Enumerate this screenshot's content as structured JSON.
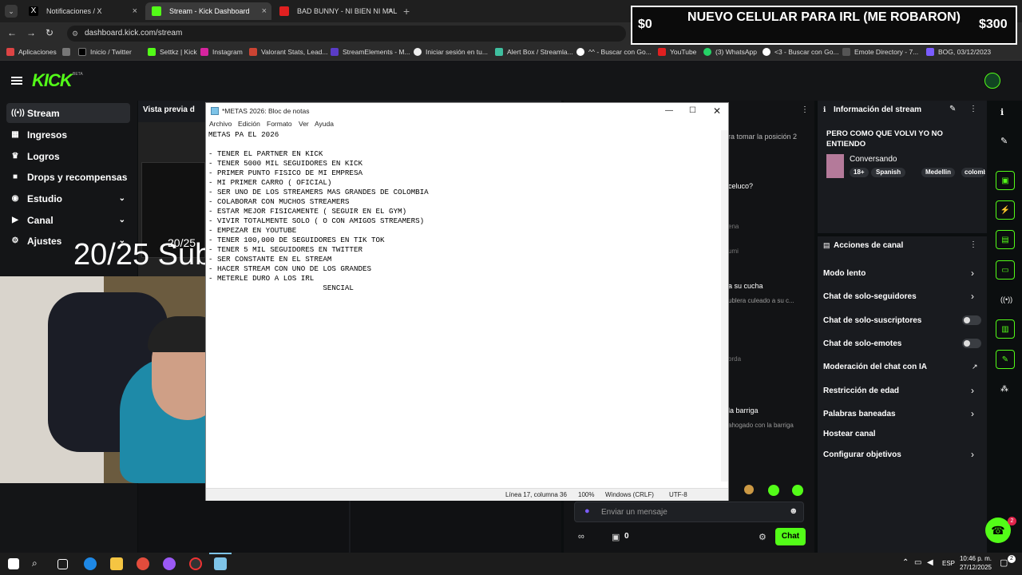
{
  "tabs": [
    {
      "label": "Notificaciones / X",
      "active": false
    },
    {
      "label": "Stream - Kick Dashboard",
      "active": true
    },
    {
      "label": "BAD BUNNY - NI BIEN NI MAL",
      "active": false
    }
  ],
  "address": "dashboard.kick.com/stream",
  "bookmarks": [
    "Aplicaciones",
    "Inicio / Twitter",
    "Settkz | Kick",
    "Instagram",
    "Valorant Stats, Lead...",
    "StreamElements - M...",
    "Iniciar sesión en tu...",
    "Alert Box / Streamla...",
    "^^ - Buscar con Go...",
    "YouTube",
    "(3) WhatsApp",
    "<3 - Buscar con Go...",
    "Emote Directory - 7...",
    "BOG, 03/12/2023"
  ],
  "overlay": {
    "left_amount": "$0",
    "title": "NUEVO CELULAR PARA IRL (ME ROBARON)",
    "right_amount": "$300"
  },
  "kick": {
    "logo": "KICK",
    "logo_badge": "BETA",
    "nav": [
      {
        "label": "Stream",
        "icon": "radio-icon",
        "active": true,
        "chevron": false
      },
      {
        "label": "Ingresos",
        "icon": "money-icon",
        "chevron": false
      },
      {
        "label": "Logros",
        "icon": "trophy-icon",
        "chevron": false
      },
      {
        "label": "Drops y recompensas",
        "icon": "gift-icon",
        "chevron": false
      },
      {
        "label": "Estudio",
        "icon": "studio-icon",
        "chevron": true
      },
      {
        "label": "Canal",
        "icon": "channel-icon",
        "chevron": true
      },
      {
        "label": "Ajustes",
        "icon": "gear-icon",
        "chevron": true
      }
    ],
    "preview_title": "Vista previa d",
    "sub_goal": "20/25 Sub",
    "sub_goal_small": "20/25",
    "chat_fragments": [
      "ra tomar la posición 2",
      "celuco?",
      "a su cucha",
      "ublera culeado a su c...",
      "la barriga",
      "ahogado con la barriga",
      "ena",
      "umi",
      "orda"
    ],
    "chat_placeholder": "Enviar un mensaje",
    "chat_count": "0",
    "chat_button": "Chat",
    "stream_info": {
      "header": "Información del stream",
      "title": "PERO COMO QUE VOLVI YO NO ENTIENDO",
      "category": "Conversando",
      "tags": [
        "18+",
        "Spanish",
        "Medellin",
        "colombi"
      ]
    },
    "channel_actions": {
      "header": "Acciones de canal",
      "items": [
        {
          "label": "Modo lento",
          "control": "chevron"
        },
        {
          "label": "Chat de solo-seguidores",
          "control": "chevron"
        },
        {
          "label": "Chat de solo-suscriptores",
          "control": "toggle"
        },
        {
          "label": "Chat de solo-emotes",
          "control": "toggle"
        },
        {
          "label": "Moderación del chat con IA",
          "control": "external"
        },
        {
          "label": "Restricción de edad",
          "control": "chevron"
        },
        {
          "label": "Palabras baneadas",
          "control": "chevron"
        },
        {
          "label": "Hostear canal",
          "control": "none"
        },
        {
          "label": "Configurar objetivos",
          "control": "chevron"
        }
      ]
    },
    "help_badge": "2"
  },
  "notepad": {
    "title": "*METAS 2026: Bloc de notas",
    "menu": [
      "Archivo",
      "Edición",
      "Formato",
      "Ver",
      "Ayuda"
    ],
    "lines": [
      "METAS PA EL 2026",
      "",
      "- TENER EL PARTNER EN KICK",
      "- TENER 5000 MIL SEGUIDORES EN KICK",
      "- PRIMER PUNTO FISICO DE MI EMPRESA",
      "- MI PRIMER CARRO ( OFICIAL)",
      "- SER UNO DE LOS STREAMERS MAS GRANDES DE COLOMBIA",
      "- COLABORAR CON MUCHOS STREAMERS",
      "- ESTAR MEJOR FISICAMENTE ( SEGUIR EN EL GYM)",
      "- VIVIR TOTALMENTE SOLO ( O CON AMIGOS STREAMERS)",
      "- EMPEZAR EN YOUTUBE",
      "- TENER 100,000 DE SEGUIDORES EN TIK TOK",
      "- TENER 5 MIL SEGUIDORES EN TWITTER",
      "- SER CONSTANTE EN EL STREAM",
      "- HACER STREAM CON UNO DE LOS GRANDES",
      "- METERLE DURO A LOS IRL",
      "                          SENCIAL"
    ],
    "status": {
      "position": "Línea 17, columna 36",
      "zoom": "100%",
      "eol": "Windows (CRLF)",
      "encoding": "UTF-8"
    }
  },
  "taskbar": {
    "lang": "ESP",
    "time": "10:46 p. m.",
    "date": "27/12/2025",
    "badge": "2"
  }
}
